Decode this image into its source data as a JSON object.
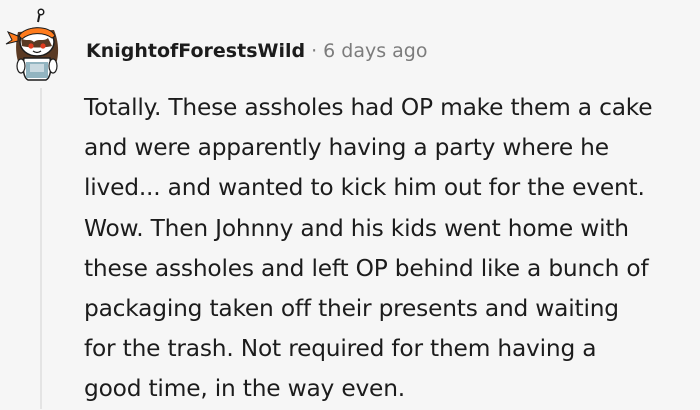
{
  "comment": {
    "username": "KnightofForestsWild",
    "separator": "·",
    "timestamp": "6 days ago",
    "avatar_icon": "reddit-snoo-avatar-icon",
    "body_lines": [
      "Totally. These assholes had OP make them a cake",
      "and were apparently having a party where he",
      "lived... and wanted to kick him out for the event.",
      "Wow. Then Johnny and his kids went home with",
      "these assholes and left OP behind like a bunch of",
      "packaging taken off their presents and waiting",
      "for the trash. Not required for them having a",
      "good time, in the way even."
    ]
  },
  "colors": {
    "background": "#f6f6f6",
    "text": "#1c1c1c",
    "meta": "#7c7c7c",
    "thread_line": "#e4e4e4"
  }
}
